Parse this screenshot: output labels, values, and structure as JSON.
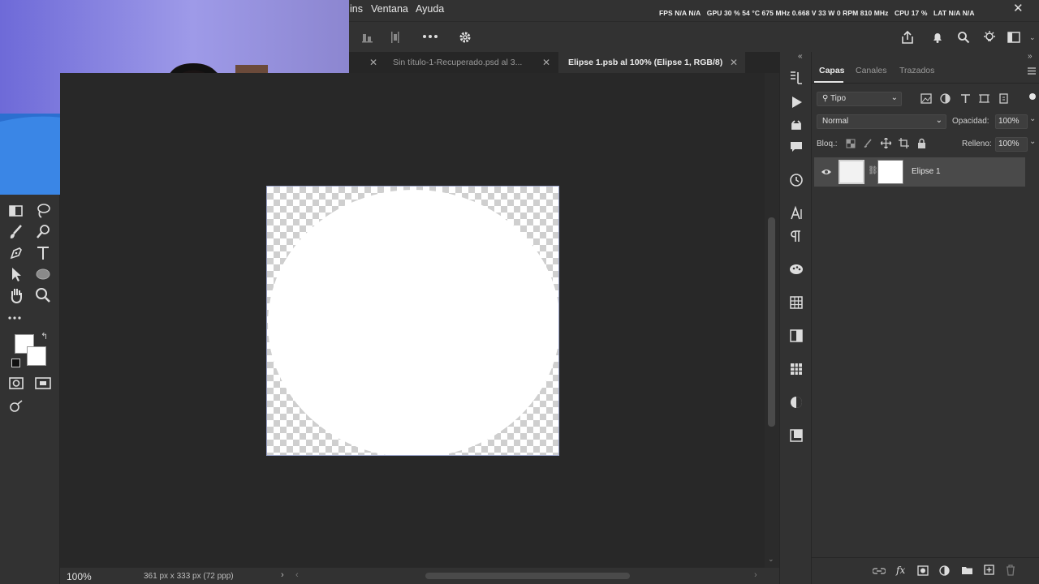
{
  "menu": {
    "items": [
      "ins",
      "Ventana",
      "Ayuda"
    ]
  },
  "stats": {
    "fps": "FPS  N/A  N/A",
    "gpu": "GPU  30 %  54 °C  675 MHz  0.668 V  33 W  0 RPM  810 MHz",
    "cpu": "CPU  17 %",
    "lat": "LAT  N/A  N/A"
  },
  "tabs": [
    {
      "label": "Sin título-1-Recuperado.psd al 3...",
      "active": false
    },
    {
      "label": "Elipse 1.psb al 100% (Elipse 1, RGB/8)",
      "active": true
    }
  ],
  "status": {
    "zoom": "100%",
    "doc_size": "361 px x 333 px (72 ppp)"
  },
  "layers_panel": {
    "tabs": [
      "Capas",
      "Canales",
      "Trazados"
    ],
    "filter": "Tipo",
    "blend_mode": "Normal",
    "opacity_label": "Opacidad:",
    "opacity_value": "100%",
    "lock_label": "Bloq.:",
    "fill_label": "Relleno:",
    "fill_value": "100%",
    "layer_name": "Elipse 1"
  },
  "colors": {
    "accent": "#323232",
    "canvas_bg": "#282828",
    "panel_bg": "#323232"
  }
}
